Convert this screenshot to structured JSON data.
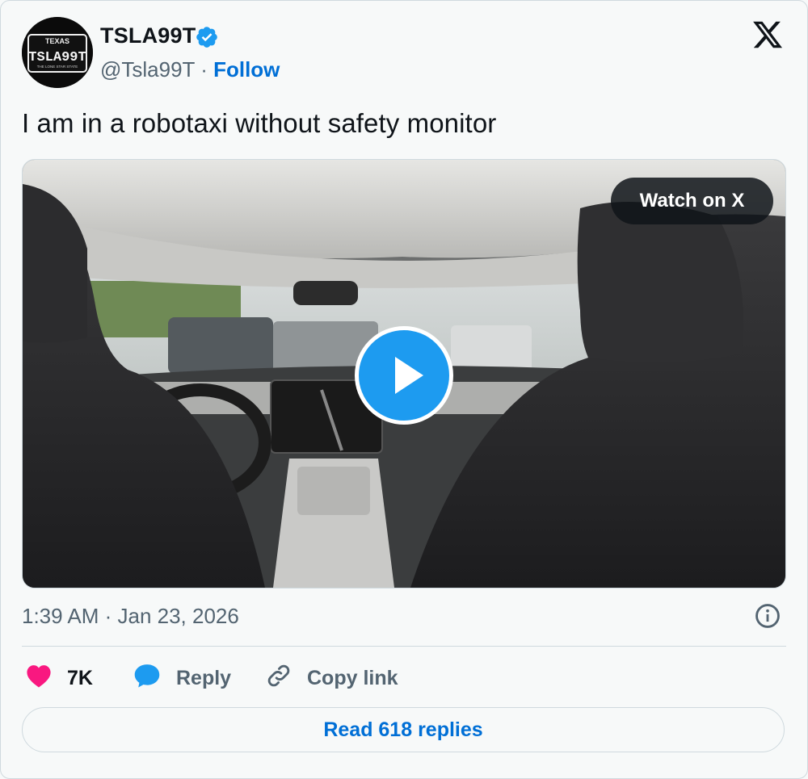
{
  "author": {
    "name": "TSLA99T",
    "handle": "@Tsla99T",
    "separator": " · ",
    "follow_label": "Follow",
    "avatar_plate": {
      "top": "TEXAS",
      "main": "TSLA99T",
      "bottom": "THE LONE STAR STATE"
    }
  },
  "tweet": {
    "text": "I am in a robotaxi without safety monitor",
    "timestamp": "1:39 AM · Jan 23, 2026"
  },
  "media": {
    "watch_label": "Watch on X",
    "type": "video"
  },
  "actions": {
    "likes_count": "7K",
    "reply_label": "Reply",
    "copy_label": "Copy link"
  },
  "footer": {
    "read_replies_label": "Read 618 replies"
  },
  "colors": {
    "accent": "#1d9bf0",
    "link": "#006fd6",
    "like": "#f91880",
    "muted": "#536471"
  },
  "icons": [
    "verified-badge-icon",
    "x-logo-icon",
    "play-icon",
    "info-icon",
    "heart-icon",
    "reply-bubble-icon",
    "link-icon"
  ]
}
